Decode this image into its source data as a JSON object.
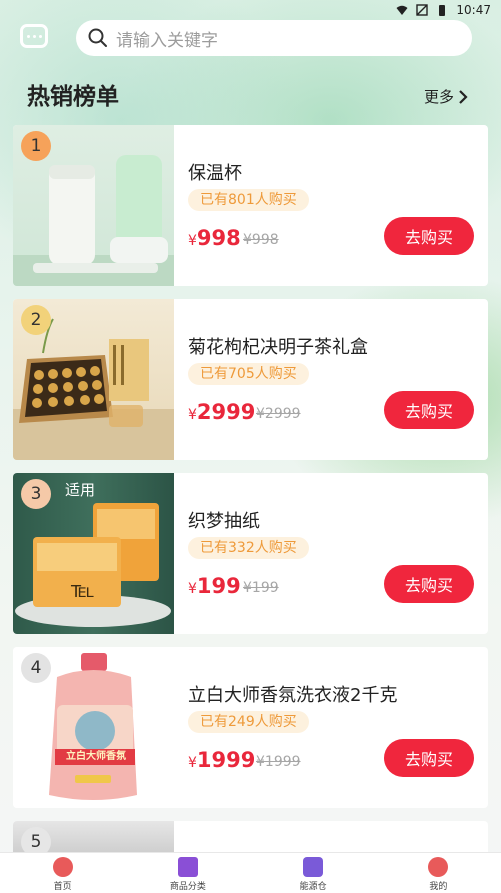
{
  "status": {
    "time": "10:47"
  },
  "search": {
    "placeholder": "请输入关键字"
  },
  "section": {
    "title": "热销榜单",
    "more": "更多"
  },
  "products": [
    {
      "rank": "1",
      "name": "保温杯",
      "sold": "已有801人购买",
      "price": "998",
      "currency": "¥",
      "old_price": "¥998",
      "buy": "去购买",
      "thumb_caption": ""
    },
    {
      "rank": "2",
      "name": "菊花枸杞决明子茶礼盒",
      "sold": "已有705人购买",
      "price": "2999",
      "currency": "¥",
      "old_price": "¥2999",
      "buy": "去购买"
    },
    {
      "rank": "3",
      "name": "织梦抽纸",
      "sold": "已有332人购买",
      "price": "199",
      "currency": "¥",
      "old_price": "¥199",
      "buy": "去购买",
      "thumb_text": "适用"
    },
    {
      "rank": "4",
      "name": "立白大师香氛洗衣液2千克",
      "sold": "已有249人购买",
      "price": "1999",
      "currency": "¥",
      "old_price": "¥1999",
      "buy": "去购买",
      "thumb_label": "立白大师香氛"
    },
    {
      "rank": "5"
    }
  ],
  "tabs": [
    {
      "label": "首页",
      "color": "#e85a5a"
    },
    {
      "label": "商品分类",
      "color": "#8a4fd6"
    },
    {
      "label": "能源仓",
      "color": "#7a5ad8"
    },
    {
      "label": "我的",
      "color": "#e85a5a"
    }
  ],
  "colors": {
    "accent": "#f0263d",
    "price": "#e9273b",
    "sold_bg": "#fdf1de",
    "sold_text": "#ee9a3a"
  }
}
